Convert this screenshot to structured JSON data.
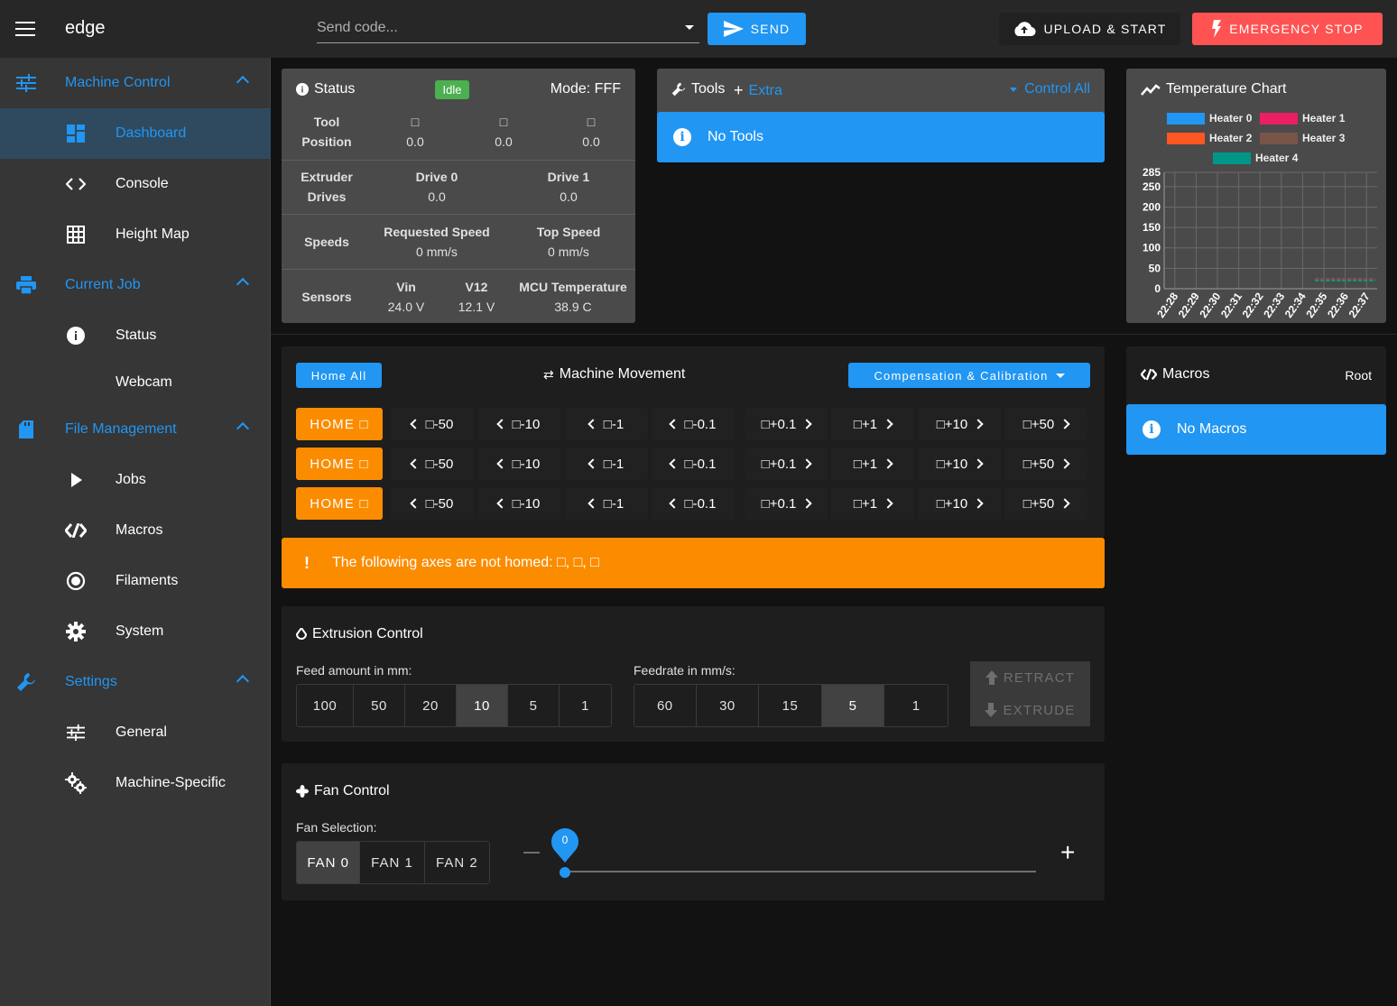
{
  "app": {
    "title": "edge"
  },
  "topbar": {
    "code_placeholder": "Send code...",
    "send_label": "Send",
    "upload_label": "Upload & Start",
    "estop_label": "Emergency Stop"
  },
  "sidebar": {
    "groups": [
      {
        "label": "Machine Control",
        "icon": "sliders-icon",
        "items": [
          {
            "label": "Dashboard",
            "icon": "dashboard-icon",
            "active": true
          },
          {
            "label": "Console",
            "icon": "code-icon"
          },
          {
            "label": "Height Map",
            "icon": "grid-icon"
          }
        ]
      },
      {
        "label": "Current Job",
        "icon": "printer-icon",
        "items": [
          {
            "label": "Status",
            "icon": "info-icon"
          },
          {
            "label": "Webcam",
            "icon": ""
          }
        ]
      },
      {
        "label": "File Management",
        "icon": "sd-card-icon",
        "items": [
          {
            "label": "Jobs",
            "icon": "play-icon"
          },
          {
            "label": "Macros",
            "icon": "macro-icon"
          },
          {
            "label": "Filaments",
            "icon": "radio-icon"
          },
          {
            "label": "System",
            "icon": "gear-icon"
          }
        ]
      },
      {
        "label": "Settings",
        "icon": "wrench-icon",
        "items": [
          {
            "label": "General",
            "icon": "sliders-icon"
          },
          {
            "label": "Machine-Specific",
            "icon": "gears-icon"
          }
        ]
      }
    ]
  },
  "status": {
    "title": "Status",
    "state": "Idle",
    "mode": "Mode: FFF",
    "tool_position_label": "Tool Position",
    "axes": [
      {
        "name": "□",
        "value": "0.0"
      },
      {
        "name": "□",
        "value": "0.0"
      },
      {
        "name": "□",
        "value": "0.0"
      }
    ],
    "extruder_label": "Extruder Drives",
    "drives": [
      {
        "name": "Drive 0",
        "value": "0.0"
      },
      {
        "name": "Drive 1",
        "value": "0.0"
      }
    ],
    "speeds_label": "Speeds",
    "speeds": [
      {
        "name": "Requested Speed",
        "value": "0 mm/s"
      },
      {
        "name": "Top Speed",
        "value": "0 mm/s"
      }
    ],
    "sensors_label": "Sensors",
    "sensors": [
      {
        "name": "Vin",
        "value": "24.0 V"
      },
      {
        "name": "V12",
        "value": "12.1 V"
      },
      {
        "name": "MCU Temperature",
        "value": "38.9 C"
      }
    ]
  },
  "tools": {
    "title": "Tools",
    "extra_label": "Extra",
    "control_all_label": "Control All",
    "empty_text": "No Tools"
  },
  "chart_data": {
    "type": "line",
    "title": "Temperature Chart",
    "xlabel": "",
    "ylabel": "",
    "ylim": [
      0,
      285
    ],
    "yticks": [
      "285",
      "250",
      "200",
      "150",
      "100",
      "50",
      "0"
    ],
    "ytick_values": [
      285,
      250,
      200,
      150,
      100,
      50,
      0
    ],
    "categories": [
      "22:28",
      "22:29",
      "22:30",
      "22:31",
      "22:32",
      "22:33",
      "22:34",
      "22:35",
      "22:36",
      "22:37"
    ],
    "series": [
      {
        "name": "Heater 0",
        "color": "#2196f3",
        "x": [
          "22:35",
          "22:37"
        ],
        "values": [
          22,
          22
        ]
      },
      {
        "name": "Heater 1",
        "color": "#e91e63",
        "x": [
          "22:35",
          "22:37"
        ],
        "values": [
          24,
          24
        ]
      },
      {
        "name": "Heater 2",
        "color": "#ff5722",
        "x": [
          "22:35",
          "22:37"
        ],
        "values": [
          21,
          21
        ]
      },
      {
        "name": "Heater 3",
        "color": "#795548",
        "x": [
          "22:35",
          "22:37"
        ],
        "values": [
          23,
          23
        ]
      },
      {
        "name": "Heater 4",
        "color": "#009688",
        "x": [
          "22:35",
          "22:37"
        ],
        "values": [
          20,
          20
        ]
      }
    ],
    "grid": true,
    "legend_position": "top"
  },
  "movement": {
    "title": "Machine Movement",
    "home_all_label": "Home All",
    "compensation_label": "Compensation & Calibration",
    "rows": [
      {
        "home_label": "Home □",
        "minus": [
          "□-50",
          "□-10",
          "□-1",
          "□-0.1"
        ],
        "plus": [
          "□+0.1",
          "□+1",
          "□+10",
          "□+50"
        ]
      },
      {
        "home_label": "Home □",
        "minus": [
          "□-50",
          "□-10",
          "□-1",
          "□-0.1"
        ],
        "plus": [
          "□+0.1",
          "□+1",
          "□+10",
          "□+50"
        ]
      },
      {
        "home_label": "Home □",
        "minus": [
          "□-50",
          "□-10",
          "□-1",
          "□-0.1"
        ],
        "plus": [
          "□+0.1",
          "□+1",
          "□+10",
          "□+50"
        ]
      }
    ],
    "warning_icon": "!",
    "warning_text": "The following axes are not homed: □, □, □"
  },
  "macros": {
    "title": "Macros",
    "root_label": "Root",
    "empty_text": "No Macros"
  },
  "extrusion": {
    "title": "Extrusion Control",
    "feed_label": "Feed amount in mm:",
    "feed_options": [
      "100",
      "50",
      "20",
      "10",
      "5",
      "1"
    ],
    "feed_selected": "10",
    "rate_label": "Feedrate in mm/s:",
    "rate_options": [
      "60",
      "30",
      "15",
      "5",
      "1"
    ],
    "rate_selected": "5",
    "retract_label": "Retract",
    "extrude_label": "Extrude"
  },
  "fan": {
    "title": "Fan Control",
    "selection_label": "Fan Selection:",
    "fans": [
      "Fan 0",
      "Fan 1",
      "Fan 2"
    ],
    "selected": "Fan 0",
    "value": "0",
    "value_fraction": 0
  },
  "colors": {
    "accent": "#2196f3",
    "warning": "#fb8c00",
    "danger": "#ff5252",
    "success": "#4caf50"
  }
}
